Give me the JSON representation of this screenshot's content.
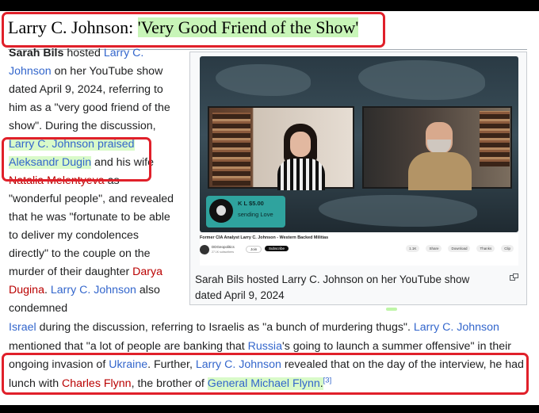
{
  "heading": {
    "prefix": "Larry C. Johnson: ",
    "quote": "'Very Good Friend of the Show'"
  },
  "left_column": {
    "seg1_bold": "Sarah Bils",
    "seg2": " hosted ",
    "seg3_link": "Larry C. Johnson",
    "seg4": " on her YouTube show dated April 9, 2024, referring to him as a \"very good friend of the show\". During the discussion, ",
    "seg5_link_hl": "Larry C. Johnson praised",
    "seg6_space": " ",
    "seg7_link_hl": "Aleksandr Dugin",
    "seg8": " and his wife ",
    "seg9_redlink": "Natalia Melentyeva",
    "seg10": " as \"wonderful people\", and revealed that he was \"fortunate to be able to deliver my condolences directly\" to the couple on the murder of their daughter ",
    "seg11_redlink": "Darya Dugina",
    "seg12": ". ",
    "seg13_link": "Larry C. Johnson",
    "seg14": " also condemned"
  },
  "figure": {
    "donation_name": "K L  $5.00",
    "donation_msg": "sending Love",
    "video_title": "Former CIA Analyst Larry C. Johnson - Western Backed Militias",
    "channel": "DDGeopolitics",
    "subs": "27.1K subscribers",
    "join": "Join",
    "subscribe": "Subscribe",
    "actions": [
      "1.1K",
      "Share",
      "Download",
      "Thanks",
      "Clip"
    ],
    "caption": "Sarah Bils hosted Larry C. Johnson on her YouTube show dated April 9, 2024"
  },
  "full_paragraph": {
    "s1_link": "Israel",
    "s2": " during the discussion, referring to Israelis as \"a bunch of murdering thugs\". ",
    "s3_link": "Larry C. Johnson",
    "s4": " mentioned that \"a lot of people are banking that ",
    "s5_link": "Russia",
    "s6": "'s going to launch a summer offensive\" in their ongoing invasion of ",
    "s7_link": "Ukraine",
    "s8": ". Further, ",
    "s9_link": "Larry C. Johnson",
    "s10": " revealed that on the day of the interview, he had lunch with ",
    "s11_redlink": "Charles Flynn",
    "s12": ", the brother of ",
    "s13_link_hl": "General Michael Flynn",
    "s14": ".",
    "s15_ref": "[3]"
  }
}
